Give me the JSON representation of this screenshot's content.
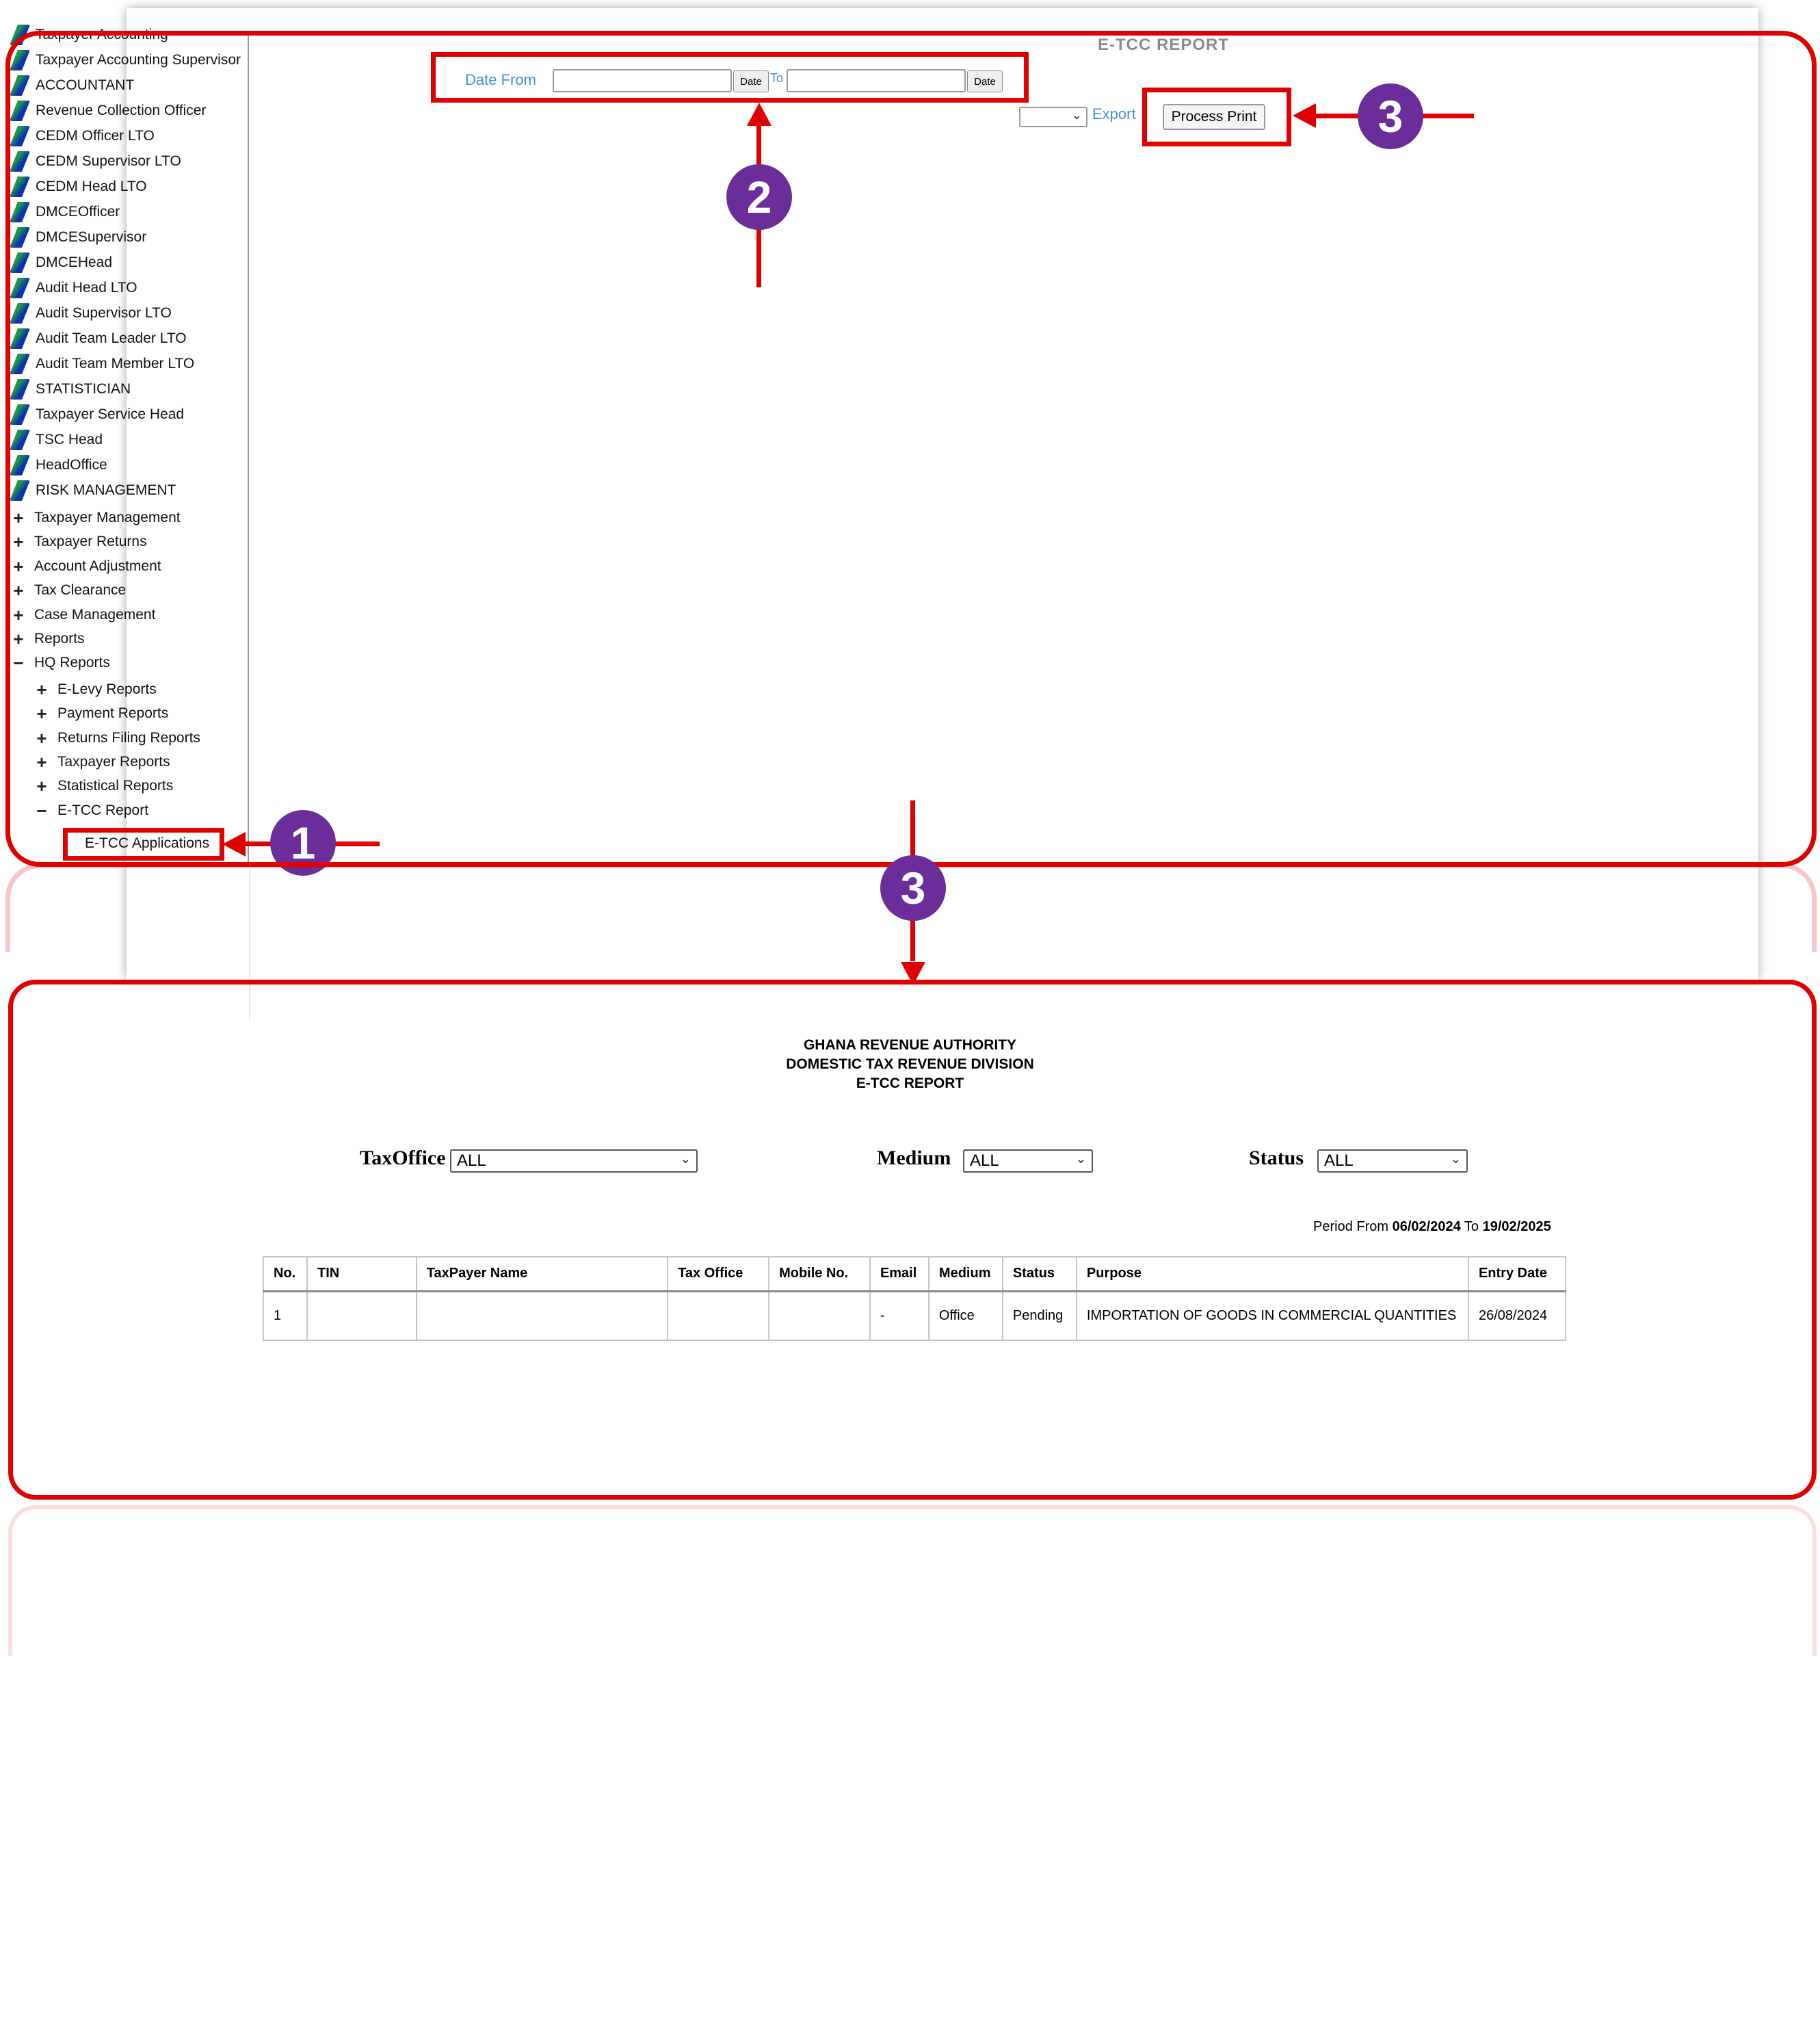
{
  "sidebar": {
    "roles": [
      "Taxpayer Accounting",
      "Taxpayer Accounting Supervisor",
      "ACCOUNTANT",
      "Revenue Collection Officer",
      "CEDM Officer LTO",
      "CEDM Supervisor LTO",
      "CEDM Head LTO",
      "DMCEOfficer",
      "DMCESupervisor",
      "DMCEHead",
      "Audit Head LTO",
      "Audit Supervisor LTO",
      "Audit Team Leader LTO",
      "Audit Team Member LTO",
      "STATISTICIAN",
      "Taxpayer Service Head",
      "TSC Head",
      "HeadOffice",
      "RISK MANAGEMENT"
    ],
    "menu": [
      {
        "sign": "+",
        "label": "Taxpayer Management"
      },
      {
        "sign": "+",
        "label": "Taxpayer Returns"
      },
      {
        "sign": "+",
        "label": "Account Adjustment"
      },
      {
        "sign": "+",
        "label": "Tax Clearance"
      },
      {
        "sign": "+",
        "label": "Case Management"
      },
      {
        "sign": "+",
        "label": "Reports"
      },
      {
        "sign": "−",
        "label": "HQ Reports"
      }
    ],
    "submenu": [
      {
        "sign": "+",
        "label": "E-Levy Reports"
      },
      {
        "sign": "+",
        "label": "Payment Reports"
      },
      {
        "sign": "+",
        "label": "Returns Filing Reports"
      },
      {
        "sign": "+",
        "label": "Taxpayer Reports"
      },
      {
        "sign": "+",
        "label": "Statistical Reports"
      },
      {
        "sign": "−",
        "label": "E-TCC Report"
      }
    ],
    "active_item": "E-TCC Applications"
  },
  "top": {
    "report_title": "E-TCC REPORT",
    "date_from_label": "Date From",
    "to_label": "To",
    "date_button": "Date",
    "export_label": "Export",
    "process_print": "Process Print"
  },
  "callouts": {
    "one": "1",
    "two": "2",
    "three": "3"
  },
  "report": {
    "header_lines": [
      "GHANA REVENUE AUTHORITY",
      "DOMESTIC TAX REVENUE DIVISION",
      "E-TCC REPORT"
    ],
    "filters": {
      "taxoffice_label": "TaxOffice",
      "taxoffice_value": "ALL",
      "medium_label": "Medium",
      "medium_value": "ALL",
      "status_label": "Status",
      "status_value": "ALL"
    },
    "period": {
      "prefix": "Period From",
      "from": "06/02/2024",
      "to_word": "To",
      "to": "19/02/2025"
    },
    "columns": [
      "No.",
      "TIN",
      "TaxPayer Name",
      "Tax Office",
      "Mobile No.",
      "Email",
      "Medium",
      "Status",
      "Purpose",
      "Entry Date"
    ],
    "rows": [
      [
        "1",
        "",
        "",
        "",
        "",
        "-",
        "Office",
        "Pending",
        "IMPORTATION OF GOODS IN COMMERCIAL QUANTITIES",
        "26/08/2024"
      ]
    ]
  },
  "colors": {
    "accent_red": "#e00000",
    "callout_purple": "#6a2d9a",
    "link_blue": "#4a8ed6"
  }
}
